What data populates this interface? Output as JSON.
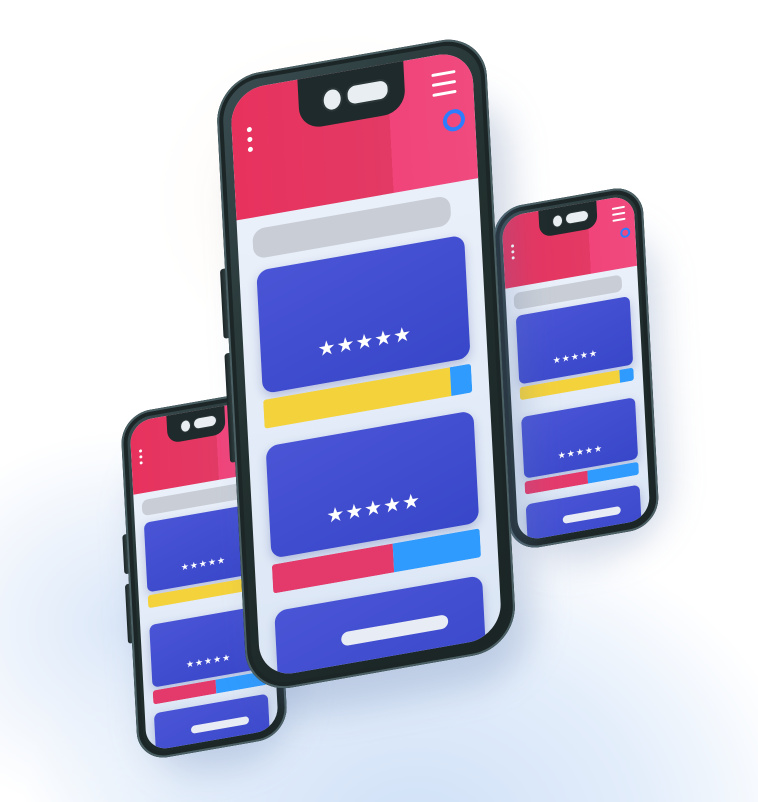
{
  "scene": {
    "background_colors": [
      "#ffffff",
      "#cfe0f7"
    ],
    "phone_body_color": "#22302f",
    "header_color": "#e8325e",
    "card_color": "#3846c9",
    "bar_colors": {
      "yellow": "#f4d23c",
      "blue": "#2f9bff",
      "pink": "#e43a6b"
    }
  },
  "phones": [
    {
      "name": "center-phone",
      "rating_stars": "★★★★★",
      "rating_stars_2": "★★★★★"
    },
    {
      "name": "left-phone",
      "rating_stars": "★★★★★",
      "rating_stars_2": "★★★★★"
    },
    {
      "name": "right-phone",
      "rating_stars": "★★★★★",
      "rating_stars_2": "★★★★★"
    }
  ],
  "icons": [
    "menu-dots-icon",
    "hamburger-icon",
    "search-icon",
    "camera-icon",
    "speaker-icon"
  ]
}
